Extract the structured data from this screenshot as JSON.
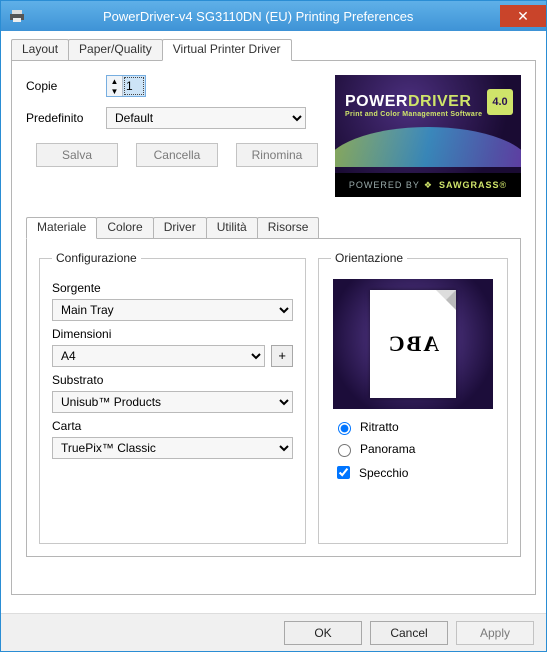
{
  "window": {
    "title": "PowerDriver-v4 SG3110DN (EU) Printing Preferences"
  },
  "outer_tabs": {
    "items": [
      {
        "label": "Layout"
      },
      {
        "label": "Paper/Quality"
      },
      {
        "label": "Virtual Printer Driver"
      }
    ],
    "active_index": 2
  },
  "copies": {
    "label": "Copie",
    "value": "1"
  },
  "preset": {
    "label": "Predefinito",
    "value": "Default"
  },
  "buttons": {
    "save": "Salva",
    "delete": "Cancella",
    "rename": "Rinomina"
  },
  "brand": {
    "name_a": "POWER",
    "name_b": "DRIVER",
    "version": "4.0",
    "tagline": "Print and Color Management Software",
    "powered": "POWERED BY",
    "vendor": "SAWGRASS"
  },
  "inner_tabs": {
    "items": [
      {
        "label": "Materiale"
      },
      {
        "label": "Colore"
      },
      {
        "label": "Driver"
      },
      {
        "label": "Utilità"
      },
      {
        "label": "Risorse"
      }
    ],
    "active_index": 0
  },
  "config": {
    "legend": "Configurazione",
    "source_label": "Sorgente",
    "source_value": "Main Tray",
    "size_label": "Dimensioni",
    "size_value": "A4",
    "plus": "+",
    "substrate_label": "Substrato",
    "substrate_value": "Unisub™ Products",
    "paper_label": "Carta",
    "paper_value": "TruePix™ Classic"
  },
  "orient": {
    "legend": "Orientazione",
    "preview_text": "ABC",
    "portrait": "Ritratto",
    "landscape": "Panorama",
    "mirror": "Specchio",
    "selected": "portrait",
    "mirror_checked": true
  },
  "dialog_buttons": {
    "ok": "OK",
    "cancel": "Cancel",
    "apply": "Apply"
  }
}
